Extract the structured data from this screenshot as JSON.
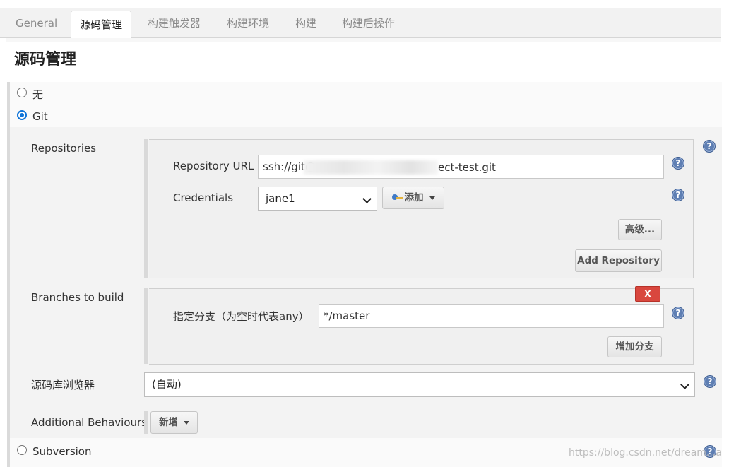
{
  "tabs": [
    {
      "label": "General",
      "active": false
    },
    {
      "label": "源码管理",
      "active": true
    },
    {
      "label": "构建触发器",
      "active": false
    },
    {
      "label": "构建环境",
      "active": false
    },
    {
      "label": "构建",
      "active": false
    },
    {
      "label": "构建后操作",
      "active": false
    }
  ],
  "section": {
    "title": "源码管理"
  },
  "scm_options": {
    "none_label": "无",
    "git_label": "Git",
    "svn_label": "Subversion",
    "selected": "Git"
  },
  "repositories": {
    "label": "Repositories",
    "url_label": "Repository URL",
    "url_prefix": "ssh://git@",
    "url_suffix": "ect-test.git",
    "credentials_label": "Credentials",
    "credentials_value": "jane1",
    "add_label": "添加",
    "advanced_label": "高级...",
    "add_repo_label": "Add Repository"
  },
  "branches": {
    "label": "Branches to build",
    "delete_label": "X",
    "specifier_label": "指定分支（为空时代表any）",
    "specifier_value": "*/master",
    "add_branch_label": "增加分支"
  },
  "browser": {
    "label": "源码库浏览器",
    "value": "(自动)"
  },
  "behaviours": {
    "label": "Additional Behaviours",
    "add_label": "新增"
  },
  "help_icon_text": "?",
  "watermark": "https://blog.csdn.net/dream...a"
}
